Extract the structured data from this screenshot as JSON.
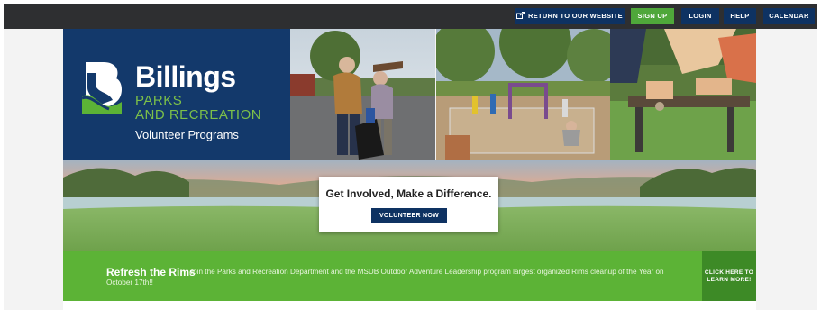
{
  "topnav": {
    "return_label": "RETURN TO OUR WEBSITE",
    "signup_label": "SIGN UP",
    "login_label": "LOGIN",
    "help_label": "HELP",
    "calendar_label": "CALENDAR"
  },
  "brand": {
    "name": "Billings",
    "sub_line1": "PARKS",
    "sub_line2": "AND RECREATION",
    "program": "Volunteer Programs"
  },
  "cta": {
    "title": "Get Involved, Make a Difference.",
    "button_label": "VOLUNTEER NOW"
  },
  "refresh": {
    "title": "Refresh the Rims",
    "text": "Join the Parks and Recreation Department and the MSUB Outdoor Adventure Leadership program largest organized Rims cleanup of the Year on October 17th!!",
    "learn_line1": "CLICK HERE TO",
    "learn_line2": "LEARN MORE!"
  },
  "colors": {
    "topbar": "#2e2f31",
    "navy": "#0e3262",
    "brand_blue": "#13396b",
    "green": "#4fa73a",
    "banner_green": "#5cb336"
  },
  "icons": {
    "return": "external-link-icon",
    "logo": "billings-b-logo-icon"
  }
}
